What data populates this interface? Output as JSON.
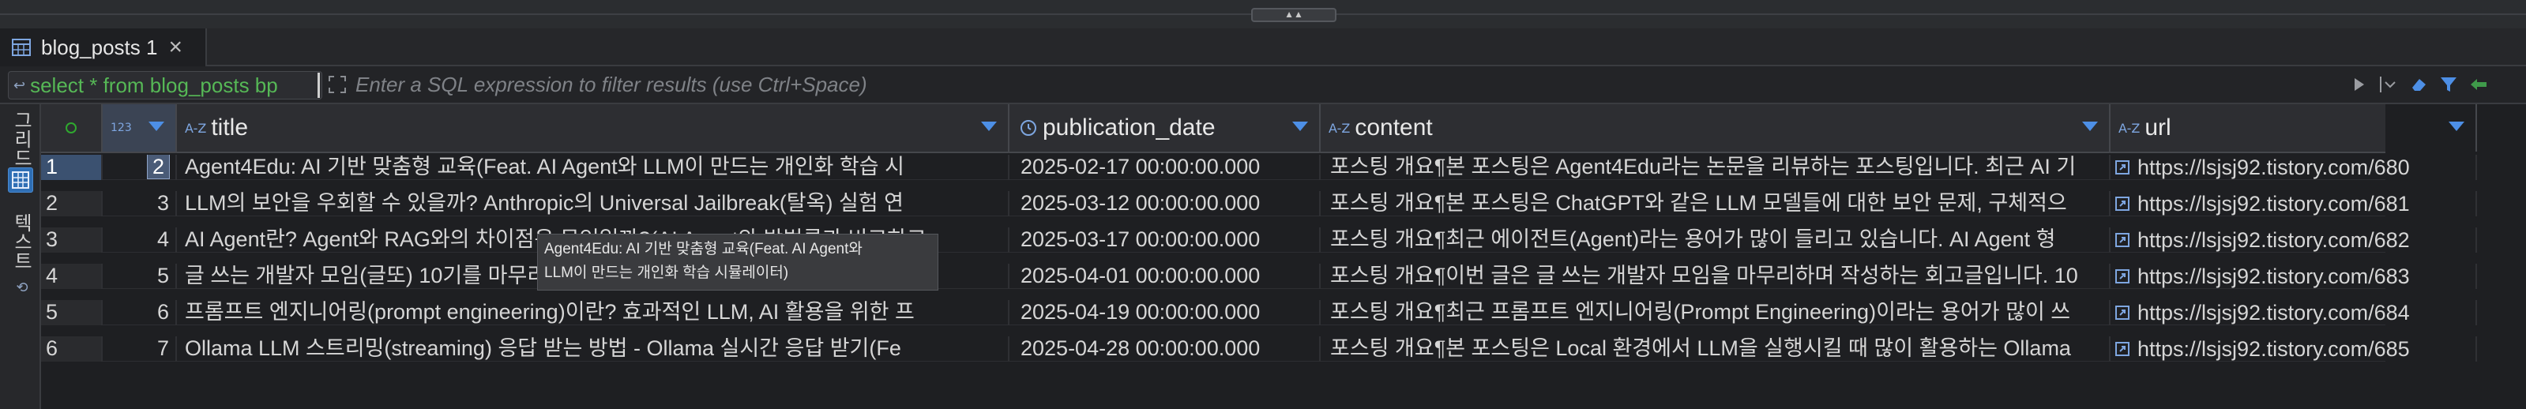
{
  "editor_tab": {
    "label": "blog_posts 1",
    "close": "×"
  },
  "filter": {
    "query": "select * from blog_posts bp",
    "placeholder": "Enter a SQL expression to filter results (use Ctrl+Space)"
  },
  "side_panel": {
    "grid_label": "그리드",
    "text_label": "텍스트"
  },
  "columns": [
    {
      "name": "",
      "type_icon": "123"
    },
    {
      "name": "title",
      "type_icon": "A-Z"
    },
    {
      "name": "publication_date",
      "type_icon": "clock"
    },
    {
      "name": "content",
      "type_icon": "A-Z"
    },
    {
      "name": "url",
      "type_icon": "A-Z"
    }
  ],
  "rows": [
    {
      "n": "1",
      "id": "2",
      "title": "Agent4Edu: AI 기반 맞춤형 교육(Feat. AI Agent와 LLM이 만드는 개인화 학습 시",
      "date": "2025-02-17 00:00:00.000",
      "content": "포스팅 개요¶본 포스팅은 Agent4Edu라는 논문을 리뷰하는 포스팅입니다. 최근 AI 기",
      "url": "https://lsjsj92.tistory.com/680"
    },
    {
      "n": "2",
      "id": "3",
      "title": "LLM의 보안을 우회할 수 있을까? Anthropic의 Universal Jailbreak(탈옥) 실험 연",
      "date": "2025-03-12 00:00:00.000",
      "content": "포스팅 개요¶본 포스팅은 ChatGPT와 같은 LLM 모델들에 대한 보안 문제, 구체적으",
      "url": "https://lsjsj92.tistory.com/681"
    },
    {
      "n": "3",
      "id": "4",
      "title": "AI Agent란? Agent와 RAG와의 차이점은 무엇일까?(AI Agent와 방법론과 비교하고",
      "date": "2025-03-17 00:00:00.000",
      "content": "포스팅 개요¶최근 에이전트(Agent)라는 용어가 많이 들리고 있습니다. AI Agent 형",
      "url": "https://lsjsj92.tistory.com/682"
    },
    {
      "n": "4",
      "id": "5",
      "title": "글 쓰는 개발자 모임(글또) 10기를 마무리하며 작성하는 회고글",
      "date": "2025-04-01 00:00:00.000",
      "content": "포스팅 개요¶이번 글은 글 쓰는 개발자 모임을 마무리하며 작성하는 회고글입니다. 10",
      "url": "https://lsjsj92.tistory.com/683"
    },
    {
      "n": "5",
      "id": "6",
      "title": "프롬프트 엔지니어링(prompt engineering)이란? 효과적인 LLM, AI 활용을 위한 프",
      "date": "2025-04-19 00:00:00.000",
      "content": "포스팅 개요¶최근 프롬프트 엔지니어링(Prompt Engineering)이라는 용어가 많이 쓰",
      "url": "https://lsjsj92.tistory.com/684"
    },
    {
      "n": "6",
      "id": "7",
      "title": "Ollama LLM 스트리밍(streaming) 응답 받는 방법 - Ollama 실시간 응답 받기(Fe",
      "date": "2025-04-28 00:00:00.000",
      "content": "포스팅 개요¶본 포스팅은 Local 환경에서 LLM을 실행시킬 때 많이 활용하는 Ollama",
      "url": "https://lsjsj92.tistory.com/685"
    }
  ],
  "tooltip": {
    "line1": "Agent4Edu: AI 기반 맞춤형 교육(Feat. AI Agent와",
    "line2": "LLM이 만드는 개인화 학습 시뮬레이터)"
  },
  "colors": {
    "accent": "#2f6fb5",
    "query_green": "#56b856",
    "sort_blue": "#4d8fe6"
  }
}
